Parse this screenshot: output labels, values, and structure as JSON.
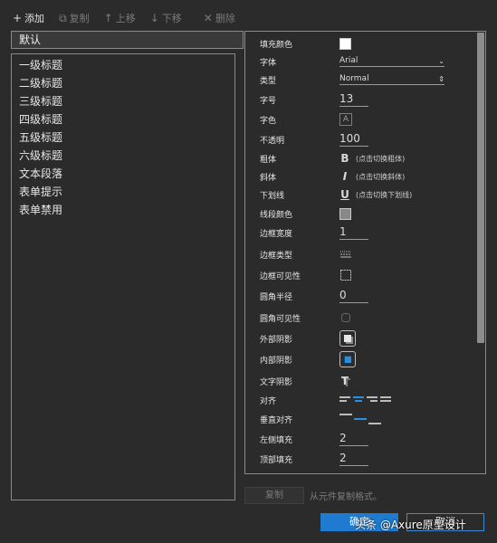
{
  "toolbar": {
    "add": "添加",
    "copy": "复制",
    "move_up": "上移",
    "move_down": "下移",
    "delete": "删除"
  },
  "default_style": "默认",
  "style_list": [
    "一级标题",
    "二级标题",
    "三级标题",
    "四级标题",
    "五级标题",
    "六级标题",
    "文本段落",
    "表单提示",
    "表单禁用"
  ],
  "properties": {
    "fill_color": "填充颜色",
    "font": "字体",
    "font_value": "Arial",
    "type": "类型",
    "type_value": "Normal",
    "font_size": "字号",
    "font_size_value": "13",
    "font_color": "字色",
    "opacity": "不透明",
    "opacity_value": "100",
    "bold": "粗体",
    "bold_hint": "(点击切换粗体)",
    "italic": "斜体",
    "italic_hint": "(点击切换斜体)",
    "underline": "下划线",
    "underline_hint": "(点击切换下划线)",
    "line_color": "线段颜色",
    "border_width": "边框宽度",
    "border_width_value": "1",
    "border_type": "边框类型",
    "border_visibility": "边框可见性",
    "corner_radius": "圆角半径",
    "corner_radius_value": "0",
    "corner_visibility": "圆角可见性",
    "outer_shadow": "外部阴影",
    "inner_shadow": "内部阴影",
    "text_shadow": "文字阴影",
    "align": "对齐",
    "vertical_align": "垂直对齐",
    "padding_left": "左侧填充",
    "padding_left_value": "2",
    "padding_top": "顶部填充",
    "padding_top_value": "2"
  },
  "footer": {
    "copy_button": "复制",
    "copy_note": "从元件复制格式。",
    "ok": "确定",
    "cancel": "取消"
  },
  "watermark": "头条 @Axure原型设计",
  "colors": {
    "accent": "#1e7bd0",
    "background": "#2b2b2b",
    "border": "#8a8a8a"
  }
}
